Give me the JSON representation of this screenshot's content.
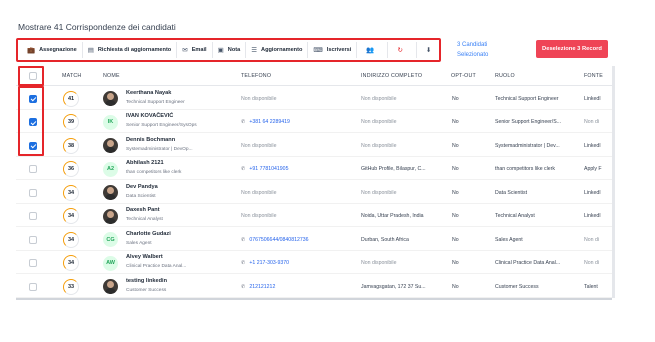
{
  "heading": "Mostrare 41 Corrispondenze dei candidati",
  "toolbar": {
    "items": [
      {
        "icon": "briefcase-icon",
        "glyph": "💼",
        "label": "Assegnazione"
      },
      {
        "icon": "document-icon",
        "glyph": "▤",
        "label": "Richiesta di aggiornamento"
      },
      {
        "icon": "email-icon",
        "glyph": "✉",
        "label": "Email"
      },
      {
        "icon": "note-icon",
        "glyph": "▣",
        "label": "Nota"
      },
      {
        "icon": "list-icon",
        "glyph": "☰",
        "label": "Aggiornamento"
      },
      {
        "icon": "keyboard-icon",
        "glyph": "⌨",
        "label": "Iscriversi"
      },
      {
        "icon": "user-add-icon",
        "glyph": "👥",
        "label": ""
      },
      {
        "icon": "sync-icon",
        "glyph": "↻",
        "label": ""
      },
      {
        "icon": "download-icon",
        "glyph": "⬇",
        "label": ""
      }
    ]
  },
  "selection": {
    "count_text": "3 Candidati Selezionato",
    "deselect_label": "Deselezione 3 Record"
  },
  "table": {
    "columns": [
      "MATCH",
      "NOME",
      "TELEFONO",
      "INDIRIZZO COMPLETO",
      "OPT-OUT",
      "RUOLO",
      "FONTE"
    ],
    "rows": [
      {
        "checked": true,
        "match": "41",
        "avatar": {
          "type": "photo",
          "initials": ""
        },
        "name": "Keerthana Nayak",
        "title": "Technical Support Engineer",
        "phone": "Non disponibile",
        "phone_link": false,
        "address": "Non disponibile",
        "opt_out": "No",
        "role": "Technical Support Engineer",
        "source": "LinkedI"
      },
      {
        "checked": true,
        "match": "39",
        "avatar": {
          "type": "initials",
          "initials": "IK"
        },
        "name": "IVAN KOVAČEVIĆ",
        "title": "Senior Support Engineer/SysOps",
        "phone": "+381 64 2289419",
        "phone_link": true,
        "address": "Non disponibile",
        "opt_out": "No",
        "role": "Senior Support Engineer/S...",
        "source": "Non di"
      },
      {
        "checked": true,
        "match": "38",
        "avatar": {
          "type": "photo",
          "initials": ""
        },
        "name": "Dennis Bochmann",
        "title": "Systemadministrator | DevOp...",
        "phone": "Non disponibile",
        "phone_link": false,
        "address": "Non disponibile",
        "opt_out": "No",
        "role": "Systemadministrator | Dev...",
        "source": "LinkedI"
      },
      {
        "checked": false,
        "match": "36",
        "avatar": {
          "type": "initials",
          "initials": "A2"
        },
        "name": "Abhilash 2121",
        "title": "than competitors like clerk",
        "phone": "+91 7781041905",
        "phone_link": true,
        "address": "GitHub Profile, Bilaspur, C...",
        "opt_out": "No",
        "role": "than competitors like clerk",
        "source": "Apply F"
      },
      {
        "checked": false,
        "match": "34",
        "avatar": {
          "type": "photo",
          "initials": ""
        },
        "name": "Dev Pandya",
        "title": "Data Scientist",
        "phone": "Non disponibile",
        "phone_link": false,
        "address": "Non disponibile",
        "opt_out": "No",
        "role": "Data Scientist",
        "source": "LinkedI"
      },
      {
        "checked": false,
        "match": "34",
        "avatar": {
          "type": "photo",
          "initials": ""
        },
        "name": "Daxesh Pant",
        "title": "Technical Analyst",
        "phone": "Non disponibile",
        "phone_link": false,
        "address": "Noida, Uttar Pradesh, India",
        "opt_out": "No",
        "role": "Technical Analyst",
        "source": "LinkedI"
      },
      {
        "checked": false,
        "match": "34",
        "avatar": {
          "type": "initials",
          "initials": "CG"
        },
        "name": "Charlotte Gudazi",
        "title": "Sales Agent",
        "phone": "0767506644/0840812736",
        "phone_link": true,
        "address": "Durban, South Africa",
        "opt_out": "No",
        "role": "Sales Agent",
        "source": "Non di"
      },
      {
        "checked": false,
        "match": "34",
        "avatar": {
          "type": "initials",
          "initials": "AW"
        },
        "name": "Alvey Walbert",
        "title": "Clinical Practice Data Anal...",
        "phone": "+1 217-303-9370",
        "phone_link": true,
        "address": "Non disponibile",
        "opt_out": "No",
        "role": "Clinical Practice Data Anal...",
        "source": "Non di"
      },
      {
        "checked": false,
        "match": "33",
        "avatar": {
          "type": "photo",
          "initials": ""
        },
        "name": "testing linkedin",
        "title": "Customer Success",
        "phone": "212121212",
        "phone_link": true,
        "address": "Jamvagsgatan, 172 37 Su...",
        "opt_out": "No",
        "role": "Customer Success",
        "source": "Talent"
      }
    ]
  },
  "colors": {
    "accent_red": "#e5252a",
    "deselect_bg": "#ef4456",
    "checkbox_blue": "#1d6fe0",
    "match_ring": "#f59e0b",
    "link_blue": "#2563eb"
  }
}
